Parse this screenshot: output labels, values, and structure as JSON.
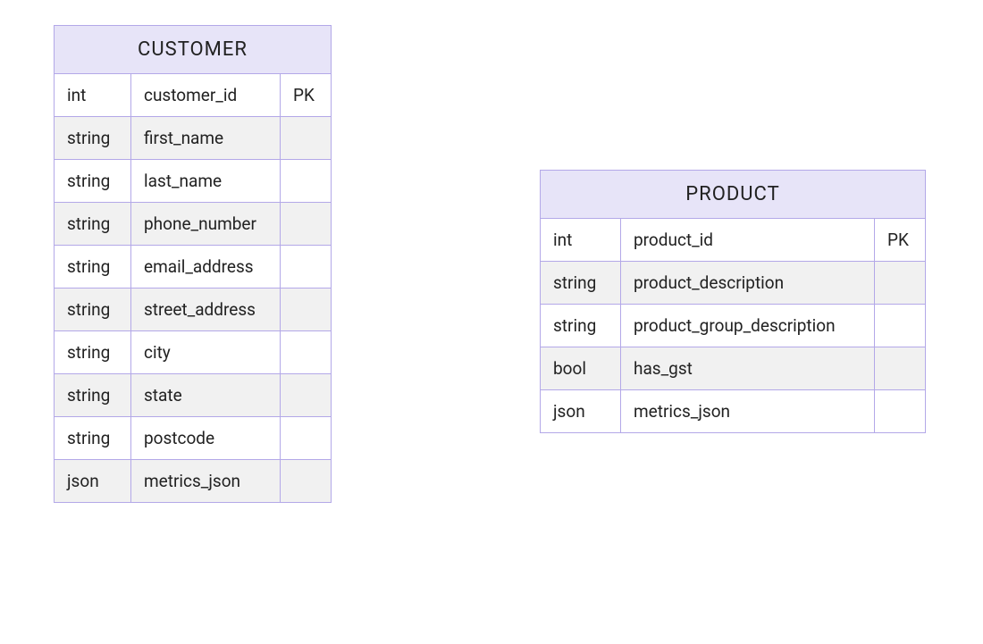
{
  "entities": {
    "customer": {
      "name": "CUSTOMER",
      "attributes": [
        {
          "type": "int",
          "name": "customer_id",
          "key": "PK"
        },
        {
          "type": "string",
          "name": "first_name",
          "key": ""
        },
        {
          "type": "string",
          "name": "last_name",
          "key": ""
        },
        {
          "type": "string",
          "name": "phone_number",
          "key": ""
        },
        {
          "type": "string",
          "name": "email_address",
          "key": ""
        },
        {
          "type": "string",
          "name": "street_address",
          "key": ""
        },
        {
          "type": "string",
          "name": "city",
          "key": ""
        },
        {
          "type": "string",
          "name": "state",
          "key": ""
        },
        {
          "type": "string",
          "name": "postcode",
          "key": ""
        },
        {
          "type": "json",
          "name": "metrics_json",
          "key": ""
        }
      ]
    },
    "product": {
      "name": "PRODUCT",
      "attributes": [
        {
          "type": "int",
          "name": "product_id",
          "key": "PK"
        },
        {
          "type": "string",
          "name": "product_description",
          "key": ""
        },
        {
          "type": "string",
          "name": "product_group_description",
          "key": ""
        },
        {
          "type": "bool",
          "name": "has_gst",
          "key": ""
        },
        {
          "type": "json",
          "name": "metrics_json",
          "key": ""
        }
      ]
    }
  },
  "colors": {
    "border": "#b3a8e8",
    "header_bg": "#e7e4f8",
    "alt_row_bg": "#f1f1f1"
  }
}
